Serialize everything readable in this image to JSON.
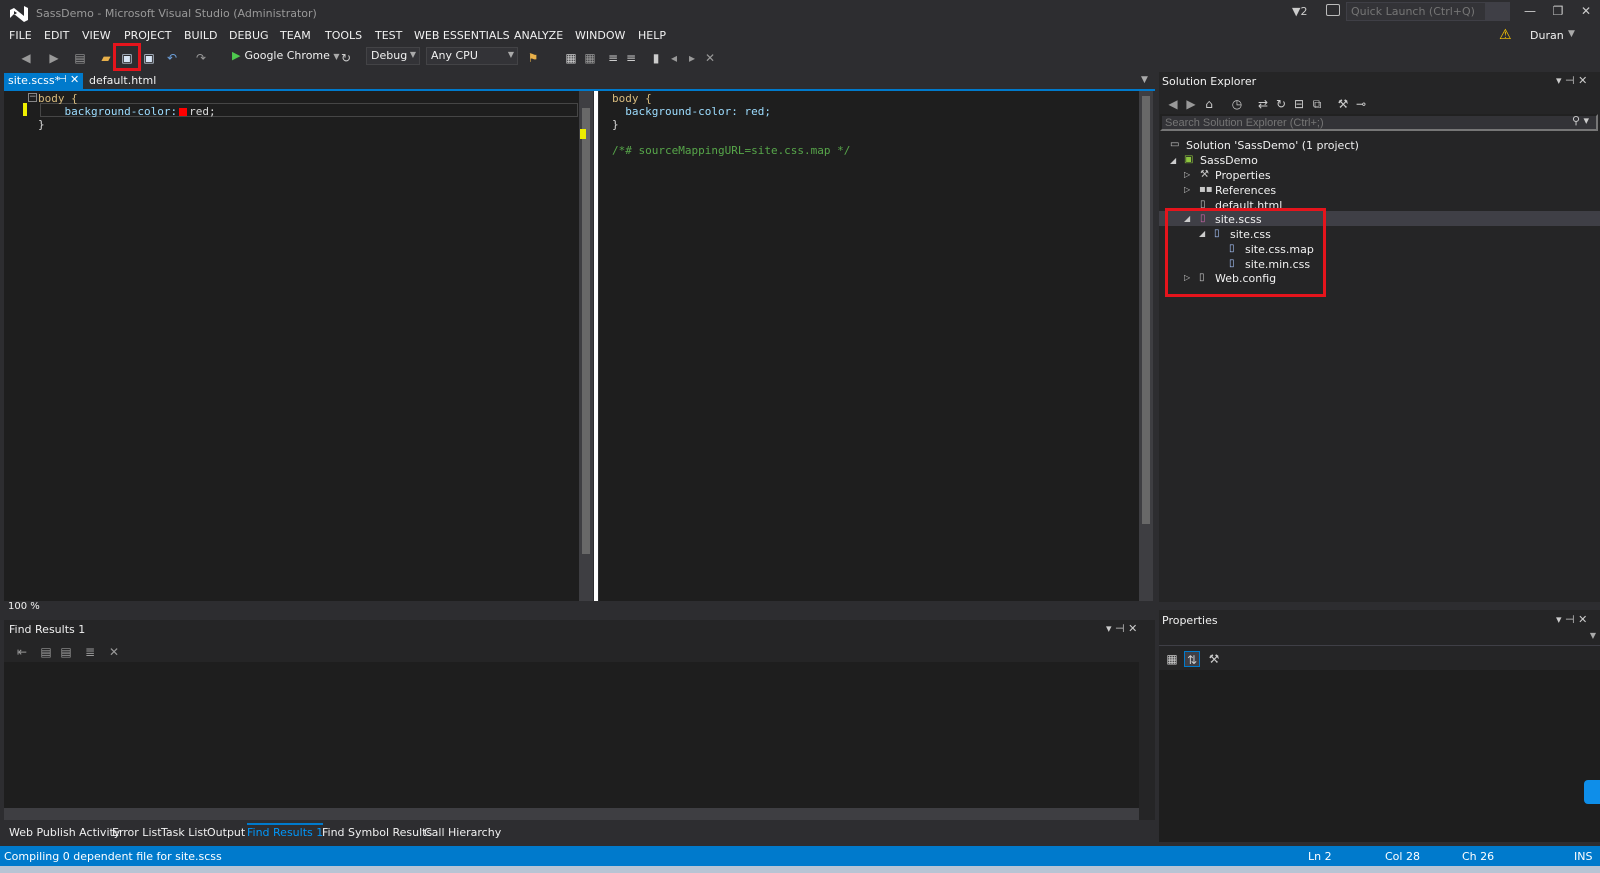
{
  "window": {
    "title": "SassDemo - Microsoft Visual Studio (Administrator)",
    "notification_count": "2",
    "quick_launch_placeholder": "Quick Launch (Ctrl+Q)",
    "user": "Duran"
  },
  "menu": [
    "FILE",
    "EDIT",
    "VIEW",
    "PROJECT",
    "BUILD",
    "DEBUG",
    "TEAM",
    "TOOLS",
    "TEST",
    "WEB ESSENTIALS",
    "ANALYZE",
    "WINDOW",
    "HELP"
  ],
  "toolbar": {
    "run_target": "Google Chrome",
    "configuration": "Debug",
    "platform": "Any CPU"
  },
  "editor": {
    "tabs": [
      {
        "label": "site.scss*",
        "active": true
      },
      {
        "label": "default.html",
        "active": false
      }
    ],
    "left_code": [
      "body {",
      "    background-color:",
      "red;",
      "}"
    ],
    "right_code": [
      "body {",
      "  background-color: red;",
      "}",
      "/*# sourceMappingURL=site.css.map */"
    ],
    "zoom": "100 %"
  },
  "find_results": {
    "title": "Find Results 1"
  },
  "bottom_tabs": [
    "Web Publish Activity",
    "Error List",
    "Task List",
    "Output",
    "Find Results 1",
    "Find Symbol Results",
    "Call Hierarchy"
  ],
  "solution_explorer": {
    "title": "Solution Explorer",
    "search_placeholder": "Search Solution Explorer (Ctrl+;)",
    "items": [
      {
        "label": "Solution 'SassDemo' (1 project)"
      },
      {
        "label": "SassDemo"
      },
      {
        "label": "Properties"
      },
      {
        "label": "References"
      },
      {
        "label": "default.html"
      },
      {
        "label": "site.scss"
      },
      {
        "label": "site.css"
      },
      {
        "label": "site.css.map"
      },
      {
        "label": "site.min.css"
      },
      {
        "label": "Web.config"
      }
    ]
  },
  "properties": {
    "title": "Properties"
  },
  "status": {
    "message": "Compiling 0 dependent file for site.scss",
    "line": "Ln 2",
    "col": "Col 28",
    "ch": "Ch 26",
    "mode": "INS"
  },
  "colors": {
    "accent": "#007acc",
    "highlight": "#e5141c",
    "swatch": "#ff0000"
  }
}
